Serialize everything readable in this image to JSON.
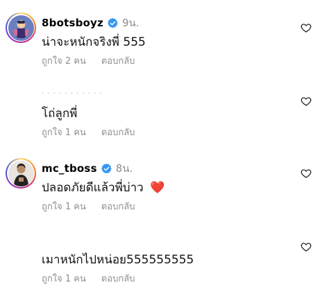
{
  "comments": [
    {
      "username": "8botsboyz",
      "time": "9น.",
      "text": "น่าจะหนักจริงพี่ 555",
      "likes": "ถูกใจ 2 คน",
      "reply": "ตอบกลับ",
      "has_avatar": true,
      "verified": true
    },
    {
      "username": "",
      "time": "",
      "text": "โถ่ลูกพี่",
      "likes": "ถูกใจ 1 คน",
      "reply": "ตอบกลับ",
      "has_avatar": false,
      "verified": false
    },
    {
      "username": "mc_tboss",
      "time": "8น.",
      "text": "ปลอดภัยดีแล้วพี่บ่าว",
      "emoji": "❤️",
      "likes": "ถูกใจ 1 คน",
      "reply": "ตอบกลับ",
      "has_avatar": true,
      "verified": true
    },
    {
      "username": "",
      "time": "",
      "text": "เมาหนักไปหน่อย555555555",
      "likes": "ถูกใจ 1 คน",
      "reply": "ตอบกลับ",
      "has_avatar": false,
      "verified": false
    }
  ],
  "colors": {
    "verified": "#3897f0",
    "muted": "#8e8e8e",
    "heart_emoji": "#e0245e"
  },
  "icons": {
    "like": "heart-outline-icon",
    "verified": "verified-badge-icon"
  }
}
